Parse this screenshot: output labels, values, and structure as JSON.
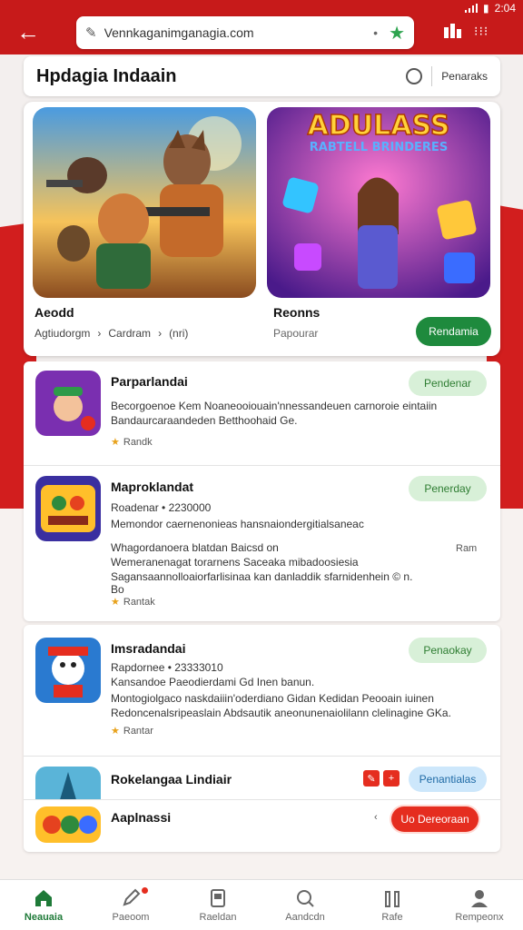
{
  "status": {
    "time": "2:04"
  },
  "browser": {
    "url": "Vennkaganimganagia.com"
  },
  "header": {
    "title": "Hpdagia Indaain",
    "right_label": "Penaraks"
  },
  "featured": [
    {
      "name": "Aeodd",
      "meta1": "Agtiudorgm",
      "meta2": "Cardram",
      "meta3": "(nri)"
    },
    {
      "name": "Reonns",
      "sub": "Papourar",
      "button": "Rendamia",
      "art_title": "ADULASS",
      "art_sub": "RABTELL BRINDERES"
    }
  ],
  "apps": [
    {
      "title": "Parparlandai",
      "lines": [
        "Becorgoenoe Kem Noaneooiouain'nnessandeuen carnoroie eintaiin",
        "Bandaurcaraandeden Betthoohaid Ge."
      ],
      "rating": "Randk",
      "button": "Pendenar"
    },
    {
      "title": "Maproklandat",
      "lines": [
        "Roadenar • 2230000",
        "Memondor caernenonieas hansnaiondergitialsaneac",
        "Whagordanoera blatdan Baicsd on",
        "Wemeranenagat torarnens Saceaka mibadoosiesia",
        "Sagansaannolloaiorfarlisinaa kan danladdik sfarnidenhein © n.",
        "Bo"
      ],
      "rating": "Rantak",
      "button": "Penerday",
      "side": "Ram"
    },
    {
      "title": "Imsradandai",
      "lines": [
        "Rapdornee • 23333010",
        "Kansandoe Paeodierdami Gd Inen banun.",
        "Montogiolgaco naskdaiiin'oderdiano Gidan Kedidan Peooain iuinen",
        "Redoncenalsripeaslain Abdsautik aneonunenaiolilann clelinagine GKa."
      ],
      "rating": "Rantar",
      "button": "Penaokay"
    },
    {
      "title": "Rokelangaa Lindiair",
      "button": "Penantialas"
    },
    {
      "title": "Aaplnassi",
      "button": "Uo Dereoraan"
    }
  ],
  "nav": [
    {
      "label": "Neauaia",
      "icon": "home-icon"
    },
    {
      "label": "Paeoom",
      "icon": "edit-icon"
    },
    {
      "label": "Raeldan",
      "icon": "bookmark-icon"
    },
    {
      "label": "Aandcdn",
      "icon": "search-icon"
    },
    {
      "label": "Rafe",
      "icon": "bars-icon"
    },
    {
      "label": "Rempeonx",
      "icon": "person-icon"
    }
  ],
  "colors": {
    "brand_red": "#c71a1a",
    "accent_green": "#1e8a3d",
    "install_red": "#e52d1f"
  }
}
